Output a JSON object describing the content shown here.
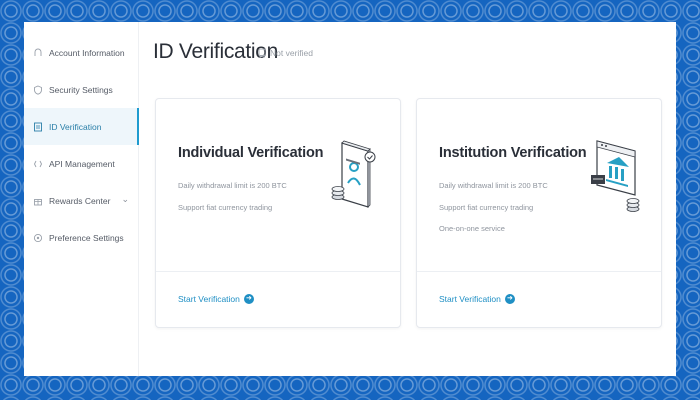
{
  "sidebar": {
    "items": [
      {
        "label": "Account Information",
        "icon": "id-card-icon",
        "active": false
      },
      {
        "label": "Security Settings",
        "icon": "shield-icon",
        "active": false
      },
      {
        "label": "ID Verification",
        "icon": "id-document-icon",
        "active": true
      },
      {
        "label": "API Management",
        "icon": "api-icon",
        "active": false
      },
      {
        "label": "Rewards Center",
        "icon": "gift-icon",
        "active": false,
        "expandable": true
      },
      {
        "label": "Preference Settings",
        "icon": "preference-icon",
        "active": false
      }
    ]
  },
  "header": {
    "title": "ID Verification",
    "status": "Not verified",
    "status_icon": "unverified-badge-icon"
  },
  "cards": [
    {
      "title": "Individual Verification",
      "lines": [
        "Daily withdrawal limit is 200 BTC",
        "Support fiat currency trading"
      ],
      "action": "Start Verification",
      "illustration": "user-document-icon"
    },
    {
      "title": "Institution Verification",
      "lines": [
        "Daily withdrawal limit is 200 BTC",
        "Support fiat currency trading",
        "One-on-one service"
      ],
      "action": "Start Verification",
      "illustration": "institution-building-icon"
    }
  ],
  "colors": {
    "accent": "#1f8fc4",
    "active_bg": "#eef6fb",
    "background_pattern": "#1565c0"
  }
}
